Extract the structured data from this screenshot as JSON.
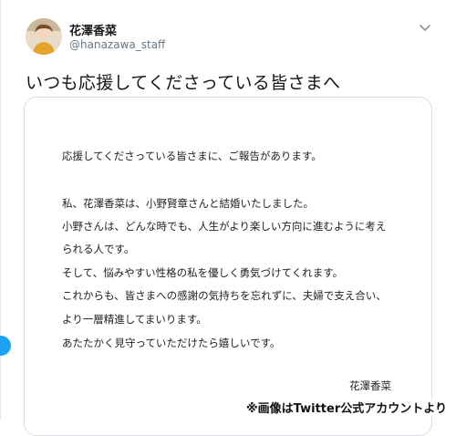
{
  "tweet": {
    "author": {
      "display_name": "花澤香菜",
      "handle": "@hanazawa_staff",
      "avatar_icon": "profile-photo"
    },
    "menu_icon": "chevron-down-icon",
    "text": "いつも応援してくださっている皆さまへ",
    "image": {
      "letter_lines": [
        "応援してくださっている皆さまに、ご報告があります。",
        "私、花澤香菜は、小野賢章さんと結婚いたしました。",
        "小野さんは、どんな時でも、人生がより楽しい方向に進むように考え",
        "られる人です。",
        "そして、悩みやすい性格の私を優しく勇気づけてくれます。",
        "これからも、皆さまへの感謝の気持ちを忘れずに、夫婦で支え合い、",
        "より一層精進してまいります。",
        "あたたかく見守っていただけたら嬉しいです。"
      ],
      "signature": "花澤香菜"
    }
  },
  "caption": "※画像はTwitter公式アカウントより",
  "colors": {
    "accent": "#1da1f2",
    "secondary_text": "#657786",
    "border": "#d7dde3"
  }
}
